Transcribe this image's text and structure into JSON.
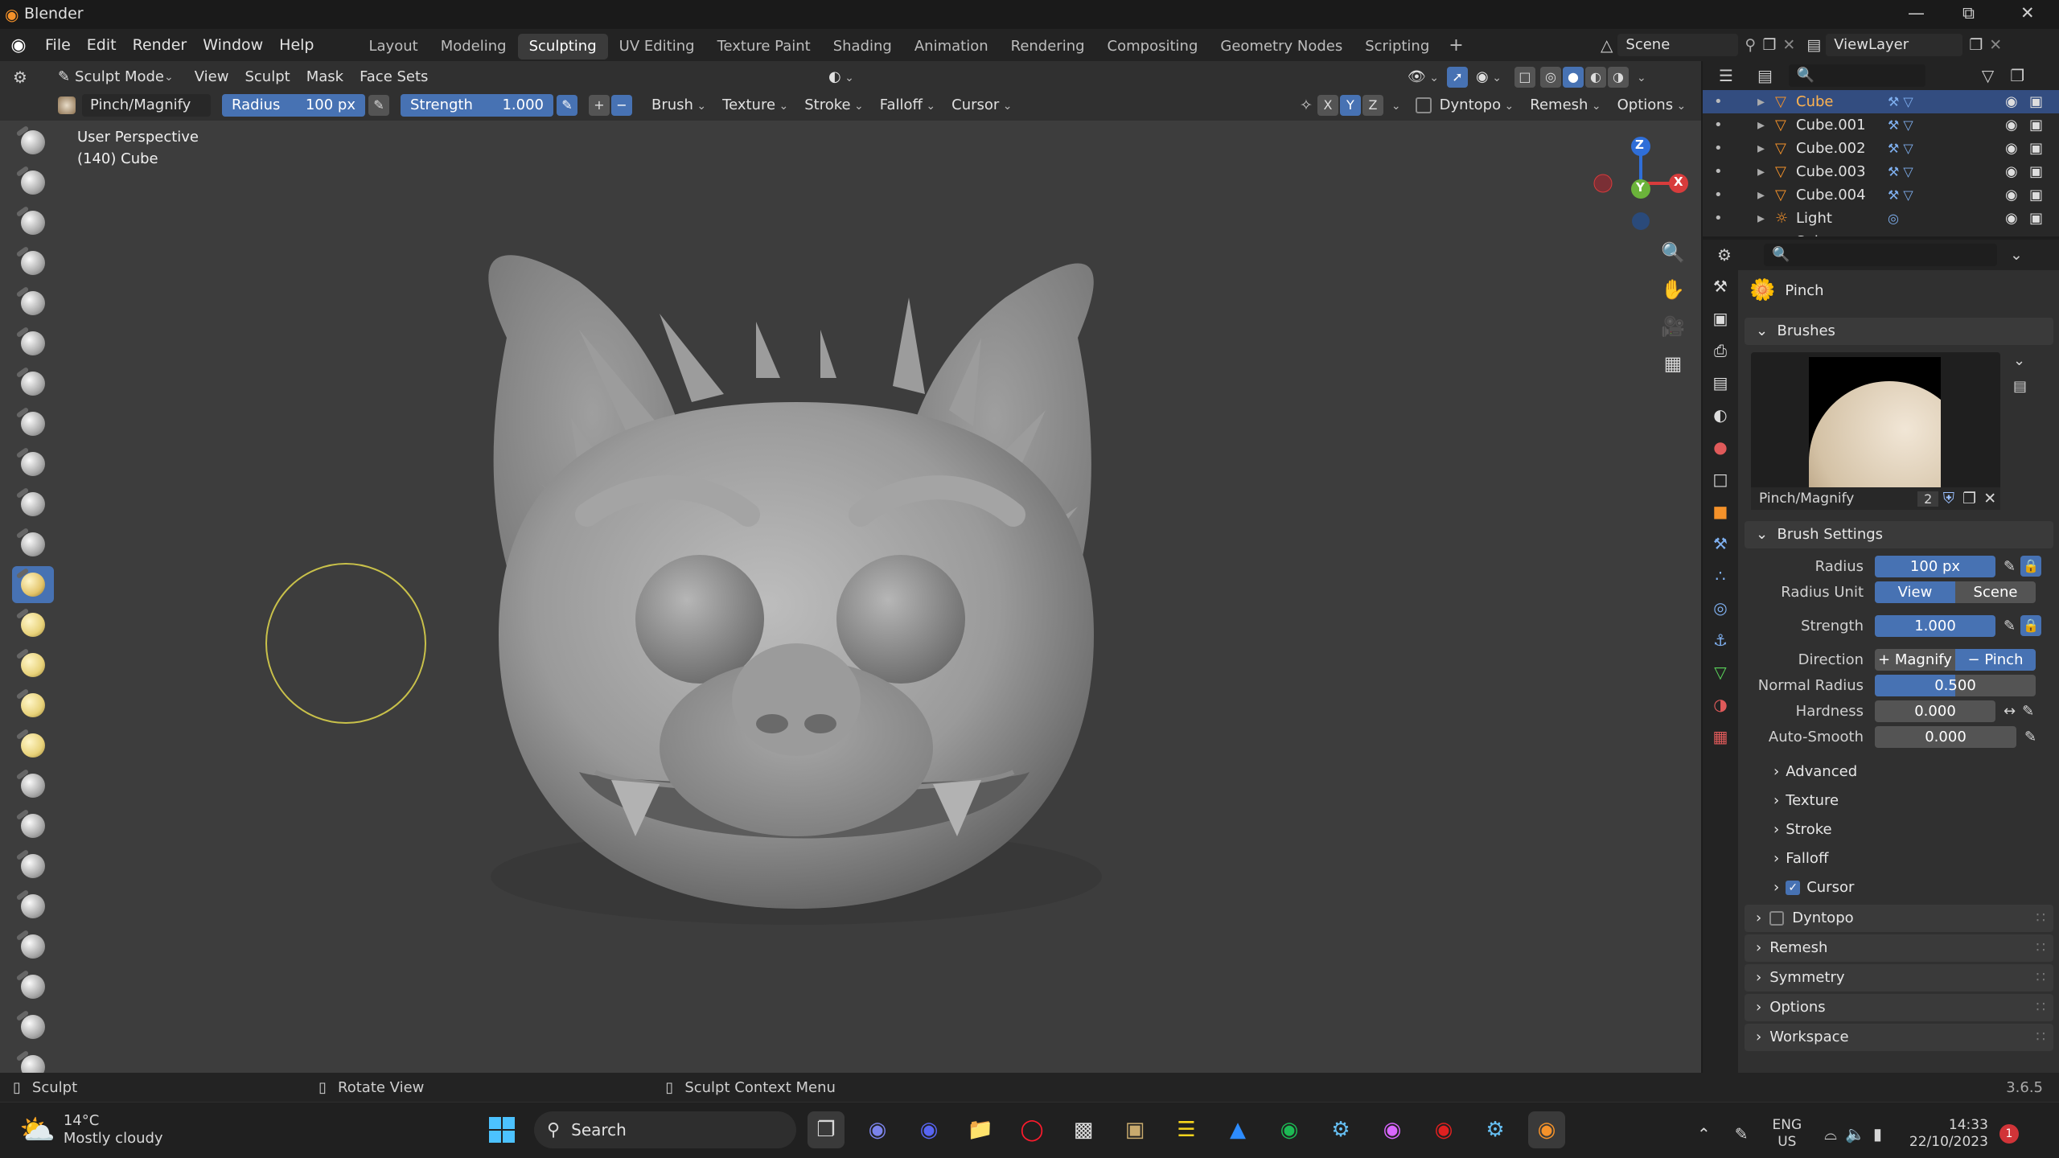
{
  "app": {
    "title": "Blender"
  },
  "menu": [
    "File",
    "Edit",
    "Render",
    "Window",
    "Help"
  ],
  "workspaces": [
    "Layout",
    "Modeling",
    "Sculpting",
    "UV Editing",
    "Texture Paint",
    "Shading",
    "Animation",
    "Rendering",
    "Compositing",
    "Geometry Nodes",
    "Scripting"
  ],
  "active_workspace": "Sculpting",
  "scene": {
    "name": "Scene",
    "view_layer": "ViewLayer"
  },
  "header": {
    "mode": "Sculpt Mode",
    "menus": [
      "View",
      "Sculpt",
      "Mask",
      "Face Sets"
    ],
    "brush_name": "Pinch/Magnify",
    "radius_label": "Radius",
    "radius_value": "100 px",
    "strength_label": "Strength",
    "strength_value": "1.000",
    "dropdowns": [
      "Brush",
      "Texture",
      "Stroke",
      "Falloff",
      "Cursor"
    ],
    "axes": [
      "X",
      "Y",
      "Z"
    ],
    "right_dropdowns": [
      "Dyntopo",
      "Remesh",
      "Options"
    ]
  },
  "viewport": {
    "perspective": "User Perspective",
    "object_info": "(140) Cube"
  },
  "gizmo": {
    "x": "X",
    "y": "Y",
    "z": "Z"
  },
  "outliner": {
    "items": [
      {
        "name": "Cube",
        "icon": "triangle-icon"
      },
      {
        "name": "Cube.001",
        "icon": "triangle-icon"
      },
      {
        "name": "Cube.002",
        "icon": "triangle-icon"
      },
      {
        "name": "Cube.003",
        "icon": "triangle-icon"
      },
      {
        "name": "Cube.004",
        "icon": "triangle-icon"
      },
      {
        "name": "Light",
        "icon": "light-icon"
      },
      {
        "name": "Sphere",
        "icon": "triangle-icon"
      }
    ]
  },
  "properties": {
    "tool_name": "Pinch",
    "brushes_label": "Brushes",
    "brush_preview_name": "Pinch/Magnify",
    "brush_users": "2",
    "brush_settings_label": "Brush Settings",
    "radius": {
      "label": "Radius",
      "value": "100 px"
    },
    "radius_unit": {
      "label": "Radius Unit",
      "options": [
        "View",
        "Scene"
      ],
      "selected": "View"
    },
    "strength": {
      "label": "Strength",
      "value": "1.000"
    },
    "direction": {
      "label": "Direction",
      "options": [
        "Magnify",
        "Pinch"
      ],
      "selected": "Pinch"
    },
    "normal_radius": {
      "label": "Normal Radius",
      "value": "0.500",
      "fill": 0.5
    },
    "hardness": {
      "label": "Hardness",
      "value": "0.000"
    },
    "auto_smooth": {
      "label": "Auto-Smooth",
      "value": "0.000"
    },
    "subpanels": [
      "Advanced",
      "Texture",
      "Stroke",
      "Falloff",
      "Cursor"
    ],
    "panels": [
      "Dyntopo",
      "Remesh",
      "Symmetry",
      "Options",
      "Workspace"
    ]
  },
  "status": {
    "left": "Sculpt",
    "mid": "Rotate View",
    "right": "Sculpt Context Menu",
    "version": "3.6.5"
  },
  "taskbar": {
    "weather_temp": "14°C",
    "weather_desc": "Mostly cloudy",
    "search": "Search",
    "lang1": "ENG",
    "lang2": "US",
    "time": "14:33",
    "date": "22/10/2023",
    "notif_count": "1"
  },
  "colors": {
    "accent": "#4772b3",
    "brush_circle": "#c9c14a",
    "selected_row": "#334d80"
  }
}
